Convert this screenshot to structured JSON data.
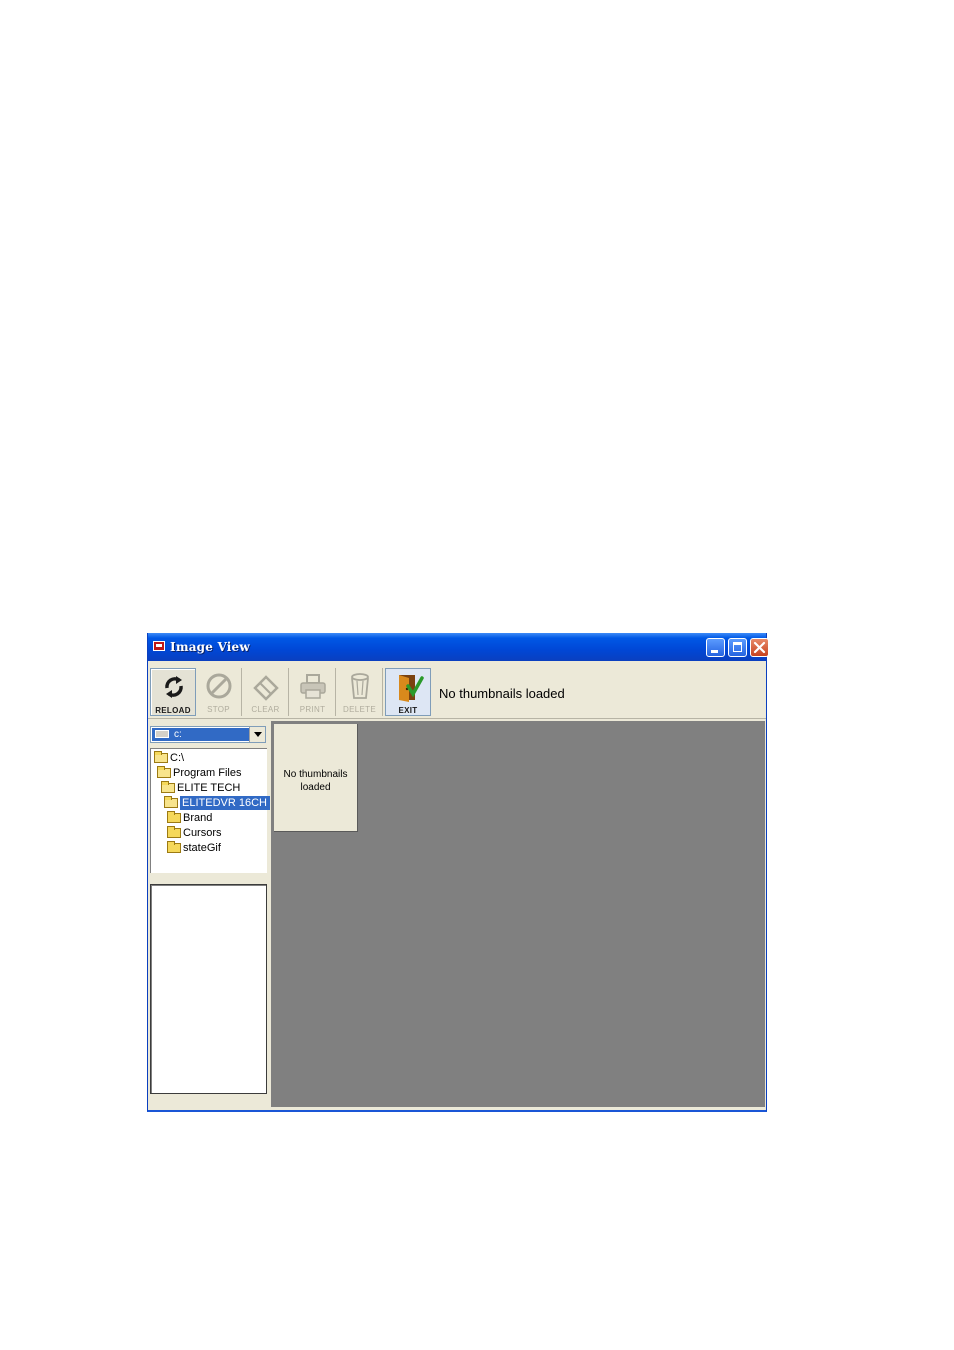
{
  "window": {
    "title": "Image View",
    "icons": {
      "app": "app-logo-icon",
      "minimize": "minimize-icon",
      "maximize": "maximize-icon",
      "close": "close-icon"
    }
  },
  "toolbar": {
    "buttons": [
      {
        "label": "RELOAD",
        "icon": "reload-icon",
        "enabled": true
      },
      {
        "label": "STOP",
        "icon": "stop-icon",
        "enabled": false
      },
      {
        "label": "CLEAR",
        "icon": "eraser-icon",
        "enabled": false
      },
      {
        "label": "PRINT",
        "icon": "printer-icon",
        "enabled": false
      },
      {
        "label": "DELETE",
        "icon": "trash-icon",
        "enabled": false
      },
      {
        "label": "EXIT",
        "icon": "exit-door-icon",
        "enabled": true
      }
    ],
    "status": "No thumbnails loaded"
  },
  "drive_select": {
    "value": "c:"
  },
  "tree": {
    "items": [
      {
        "label": "C:\\",
        "selected": false
      },
      {
        "label": "Program Files",
        "selected": false
      },
      {
        "label": "ELITE TECH",
        "selected": false
      },
      {
        "label": "ELITEDVR 16CH",
        "selected": true
      },
      {
        "label": "Brand",
        "selected": false
      },
      {
        "label": "Cursors",
        "selected": false
      },
      {
        "label": "stateGif",
        "selected": false
      }
    ]
  },
  "thumbnails": {
    "placeholder": "No thumbnails loaded"
  },
  "colors": {
    "title_bar": "#0058e6",
    "selection": "#316ac5",
    "thumb_bg": "#808080",
    "window_bg": "#ece9d8"
  }
}
